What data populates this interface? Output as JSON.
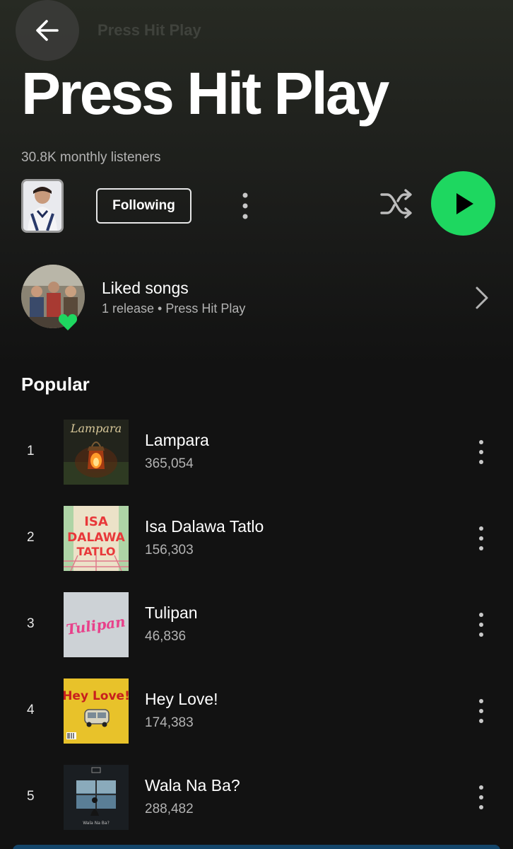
{
  "header": {
    "back_icon": "arrow-left-icon",
    "ghost_title": "Press Hit Play"
  },
  "artist": {
    "name": "Press Hit Play",
    "monthly_listeners": "30.8K monthly listeners",
    "following_label": "Following",
    "more_icon": "vertical-dots-icon",
    "shuffle_icon": "shuffle-icon",
    "play_icon": "play-icon"
  },
  "liked": {
    "title": "Liked songs",
    "subtitle": "1 release • Press Hit Play",
    "heart_icon": "heart-icon",
    "chevron_icon": "chevron-right-icon"
  },
  "popular": {
    "heading": "Popular",
    "tracks": [
      {
        "rank": "1",
        "title": "Lampara",
        "plays": "365,054",
        "art_text": "Lampara"
      },
      {
        "rank": "2",
        "title": "Isa Dalawa Tatlo",
        "plays": "156,303",
        "art_text_1": "ISA",
        "art_text_2": "DALAWA",
        "art_text_3": "TATLO"
      },
      {
        "rank": "3",
        "title": "Tulipan",
        "plays": "46,836",
        "art_text": "Tulipan"
      },
      {
        "rank": "4",
        "title": "Hey Love!",
        "plays": "174,383",
        "art_text": "Hey Love!"
      },
      {
        "rank": "5",
        "title": "Wala Na Ba?",
        "plays": "288,482",
        "art_text": "Wala Na Ba?"
      }
    ]
  },
  "colors": {
    "accent": "#1ed760",
    "background": "#121212",
    "secondary_text": "#b3b3b3"
  }
}
